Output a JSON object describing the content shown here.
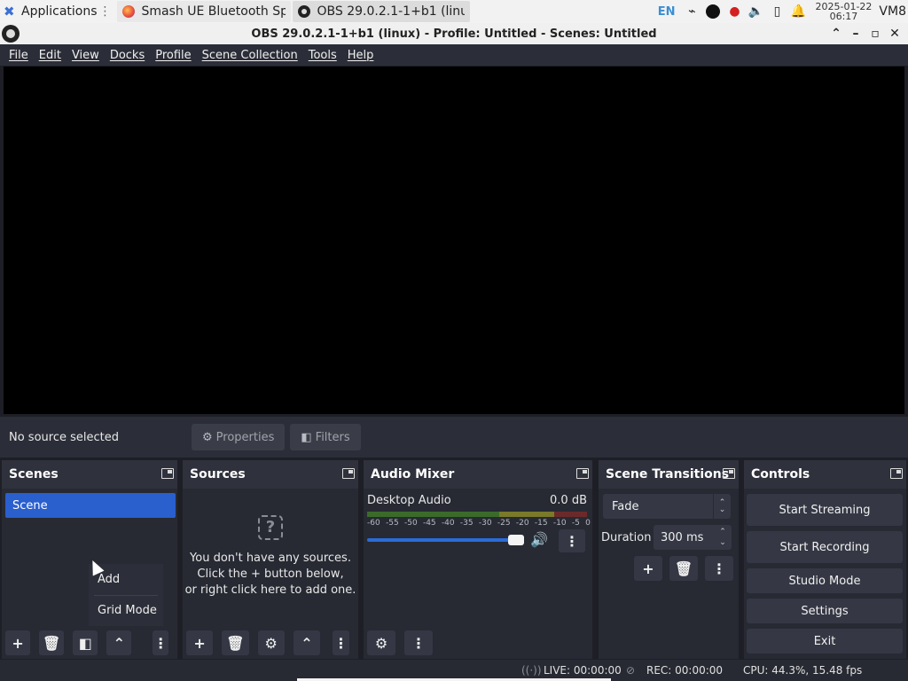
{
  "taskbar": {
    "apps_label": "Applications",
    "tasks": [
      {
        "label": "Smash UE Bluetooth Sp..."
      },
      {
        "label": "OBS 29.0.2.1-1+b1 (linu..."
      }
    ],
    "lang": "EN",
    "date": "2025-01-22",
    "time": "06:17",
    "vm": "VM8"
  },
  "window": {
    "title": "OBS 29.0.2.1-1+b1 (linux) - Profile: Untitled - Scenes: Untitled"
  },
  "menu": [
    "File",
    "Edit",
    "View",
    "Docks",
    "Profile",
    "Scene Collection",
    "Tools",
    "Help"
  ],
  "source_bar": {
    "no_source": "No source selected",
    "properties": "Properties",
    "filters": "Filters"
  },
  "scenes": {
    "title": "Scenes",
    "items": [
      "Scene"
    ],
    "context_menu": [
      "Add",
      "Grid Mode"
    ]
  },
  "sources": {
    "title": "Sources",
    "empty_lines": [
      "You don't have any sources.",
      "Click the + button below,",
      "or right click here to add one."
    ]
  },
  "mixer": {
    "title": "Audio Mixer",
    "channel": "Desktop Audio",
    "level": "0.0 dB",
    "scale": [
      "-60",
      "-55",
      "-50",
      "-45",
      "-40",
      "-35",
      "-30",
      "-25",
      "-20",
      "-15",
      "-10",
      "-5",
      "0"
    ],
    "volume_fraction": 0.96
  },
  "transitions": {
    "title": "Scene Transitions",
    "selected": "Fade",
    "duration_label": "Duration",
    "duration_value": "300 ms"
  },
  "controls": {
    "title": "Controls",
    "buttons": [
      "Start Streaming",
      "Start Recording",
      "Studio Mode",
      "Settings",
      "Exit"
    ]
  },
  "status": {
    "live": "LIVE: 00:00:00",
    "rec": "REC: 00:00:00",
    "cpu": "CPU: 44.3%, 15.48 fps"
  }
}
